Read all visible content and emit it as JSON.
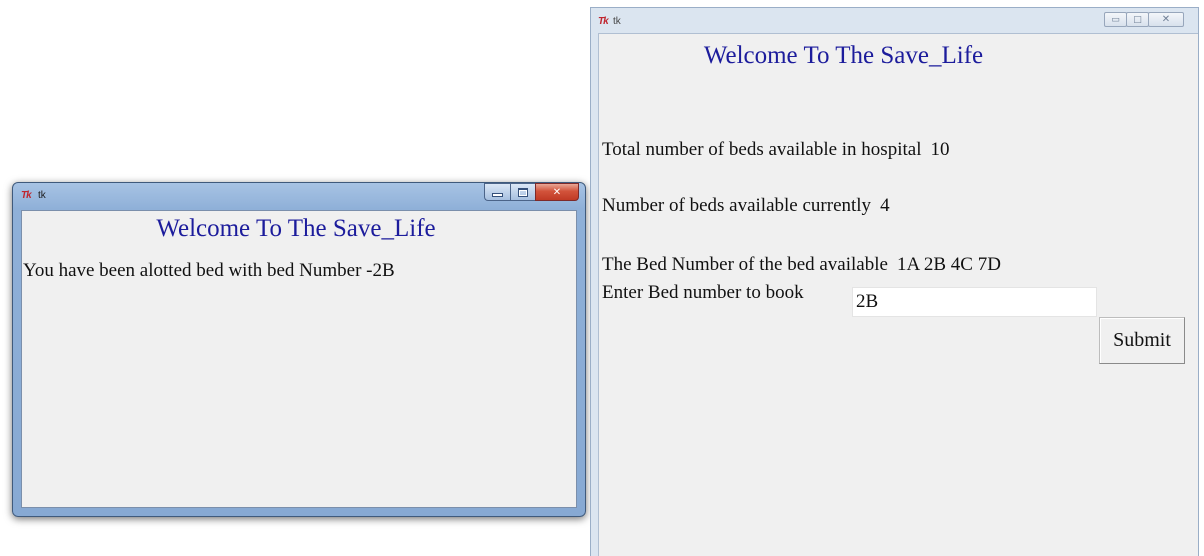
{
  "windows": {
    "result": {
      "title": "tk",
      "heading": "Welcome To The Save_Life",
      "message": "You have been alotted bed with bed Number -2B"
    },
    "booking": {
      "title": "tk",
      "heading": "Welcome To The Save_Life",
      "total_beds": {
        "label": "Total number of beds available in hospital",
        "value": "10"
      },
      "available_beds": {
        "label": "Number of beds available currently",
        "value": "4"
      },
      "bed_numbers": {
        "label": "The Bed Number of the bed available",
        "value": "1A 2B 4C 7D"
      },
      "prompt": "Enter Bed number to book",
      "bed_input_value": "2B",
      "submit_label": "Submit"
    }
  },
  "icons": {
    "app_logo": "Tk",
    "minimize": "minimize-icon",
    "maximize": "maximize-icon",
    "close": "close-icon"
  },
  "colors": {
    "heading": "#1c1c9c",
    "client_bg": "#f0f0f0",
    "close_button": "#c8422c"
  }
}
